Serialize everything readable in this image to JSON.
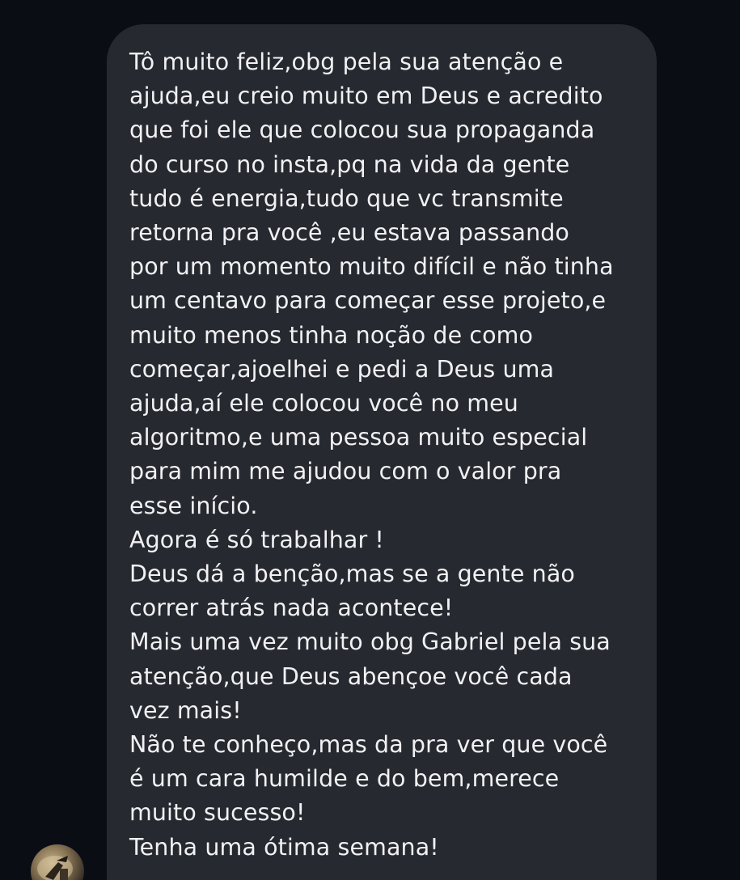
{
  "chat": {
    "message_lines": [
      "Tô muito feliz,obg pela sua atenção e",
      "ajuda,eu creio muito em Deus e acredito",
      "que foi ele que colocou sua propaganda",
      "do curso no insta,pq na vida da gente",
      "tudo é energia,tudo que vc transmite",
      "retorna pra você ,eu estava passando",
      "por um momento muito difícil e não tinha",
      "um centavo para começar esse projeto,e",
      "muito menos tinha noção de como",
      "começar,ajoelhei e pedi a Deus uma",
      "ajuda,aí ele colocou você no meu",
      "algoritmo,e uma pessoa muito especial",
      "para mim me ajudou com o valor pra",
      "esse início.",
      "Agora é só trabalhar !",
      "Deus dá a benção,mas se a gente não",
      "correr atrás nada acontece!",
      "Mais uma vez muito obg Gabriel pela sua",
      "atenção,que Deus abençoe você cada",
      "vez mais!",
      "Não te conheço,mas da pra ver que você",
      "é um cara humilde e do bem,merece",
      "muito sucesso!",
      "Tenha uma ótima semana!"
    ],
    "sender_avatar_icon": "user-avatar-photo",
    "colors": {
      "background": "#0b0d14",
      "bubble": "#262930",
      "text": "#f1f1f3"
    }
  }
}
